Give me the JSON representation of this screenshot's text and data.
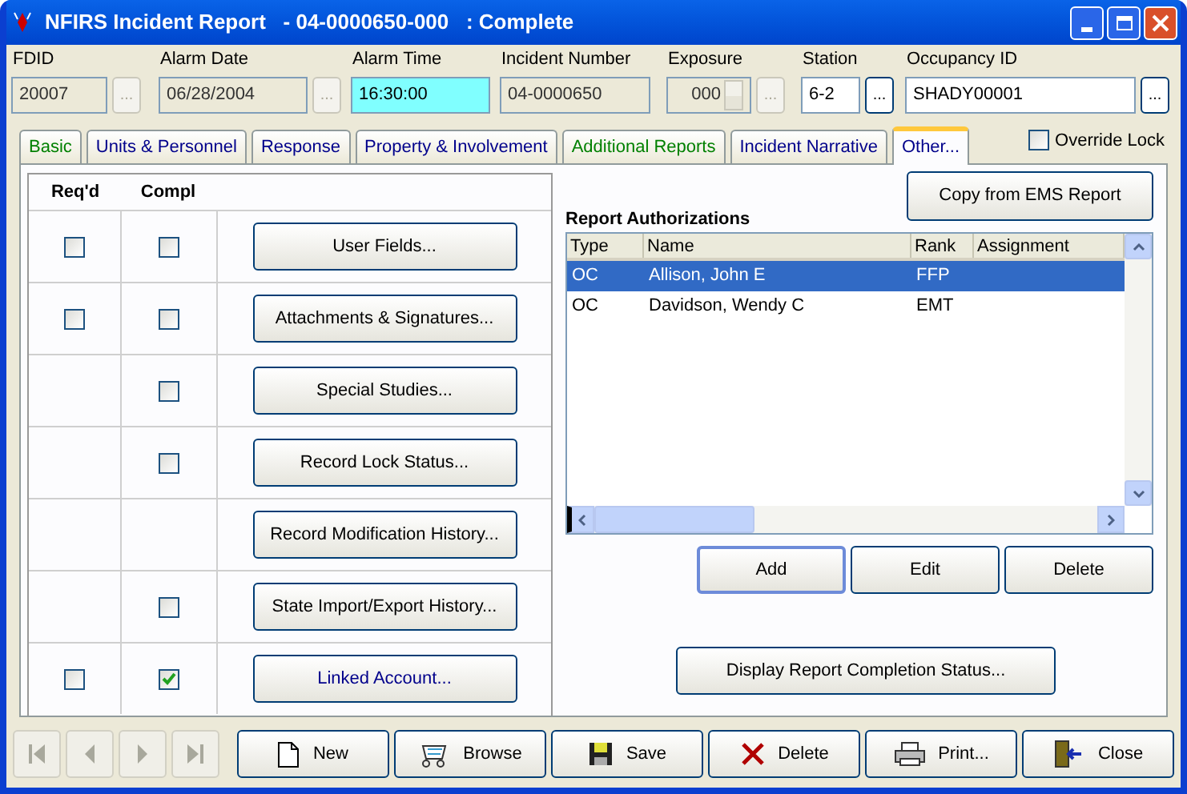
{
  "window": {
    "title": "NFIRS Incident Report   - 04-0000650-000   : Complete"
  },
  "header_fields": [
    {
      "label": "FDID",
      "value": "20007",
      "kind": "readonly",
      "browse": {
        "label": "...",
        "disabled": true
      }
    },
    {
      "label": "Alarm Date",
      "value": "06/28/2004",
      "kind": "readonly",
      "browse": {
        "label": "...",
        "disabled": true
      }
    },
    {
      "label": "Alarm Time",
      "value": "16:30:00",
      "kind": "focused"
    },
    {
      "label": "Incident Number",
      "value": "04-0000650",
      "kind": "readonly"
    },
    {
      "label": "Exposure",
      "value": "000",
      "kind": "readonly",
      "spinner": true,
      "browse": {
        "label": "...",
        "disabled": true
      }
    },
    {
      "label": "Station",
      "value": "6-2",
      "kind": "editable",
      "browse": {
        "label": "...",
        "disabled": false
      }
    },
    {
      "label": "Occupancy ID",
      "value": "SHADY00001",
      "kind": "editable",
      "browse": {
        "label": "...",
        "disabled": false
      }
    }
  ],
  "tabs": [
    {
      "label": "Basic",
      "selected": false,
      "color": "#008000"
    },
    {
      "label": "Units & Personnel",
      "selected": false,
      "color": "#00008b"
    },
    {
      "label": "Response",
      "selected": false,
      "color": "#00008b"
    },
    {
      "label": "Property & Involvement",
      "selected": false,
      "color": "#00008b"
    },
    {
      "label": "Additional Reports",
      "selected": false,
      "color": "#008000"
    },
    {
      "label": "Incident Narrative",
      "selected": false,
      "color": "#00008b"
    },
    {
      "label": "Other...",
      "selected": true,
      "color": "#00008b"
    }
  ],
  "override_lock": {
    "label": "Override Lock",
    "checked": false
  },
  "sections": {
    "columns": [
      "Req'd",
      "Compl"
    ],
    "rows": [
      {
        "reqd": {
          "checked": false
        },
        "compl": {
          "checked": false
        },
        "button": {
          "label": "User Fields...",
          "color": "#000000"
        }
      },
      {
        "reqd": {
          "checked": false
        },
        "compl": {
          "checked": false
        },
        "button": {
          "label": "Attachments & Signatures...",
          "color": "#000000"
        }
      },
      {
        "compl": {
          "checked": false
        },
        "button": {
          "label": "Special Studies...",
          "color": "#000000"
        }
      },
      {
        "compl": {
          "checked": false
        },
        "button": {
          "label": "Record Lock Status...",
          "color": "#000000"
        }
      },
      {
        "button": {
          "label": "Record Modification History...",
          "color": "#000000"
        }
      },
      {
        "compl": {
          "checked": false
        },
        "button": {
          "label": "State Import/Export History...",
          "color": "#000000"
        }
      },
      {
        "reqd": {
          "checked": false
        },
        "compl": {
          "checked": true
        },
        "button": {
          "label": "Linked Account...",
          "color": "#00008b"
        }
      }
    ]
  },
  "copy_button": "Copy from EMS Report",
  "authorizations": {
    "title": "Report Authorizations",
    "columns": [
      "Type",
      "Name",
      "Rank",
      "Assignment"
    ],
    "rows": [
      {
        "cells": [
          "OC",
          "Allison, John E",
          "FFP"
        ],
        "selected": true
      },
      {
        "cells": [
          "OC",
          "Davidson, Wendy C",
          "EMT"
        ],
        "selected": false
      }
    ],
    "buttons": [
      "Add",
      "Edit",
      "Delete"
    ]
  },
  "completion_button": "Display Report Completion Status...",
  "navigation": [
    {
      "kind": "first",
      "disabled": true
    },
    {
      "kind": "prev",
      "disabled": true
    },
    {
      "kind": "next",
      "disabled": true
    },
    {
      "kind": "last",
      "disabled": true
    }
  ],
  "toolbar": [
    {
      "kind": "new",
      "label": "New"
    },
    {
      "kind": "browse",
      "label": "Browse"
    },
    {
      "kind": "save",
      "label": "Save"
    },
    {
      "kind": "delete",
      "label": "Delete"
    },
    {
      "kind": "print",
      "label": "Print..."
    },
    {
      "kind": "close",
      "label": "Close"
    }
  ]
}
